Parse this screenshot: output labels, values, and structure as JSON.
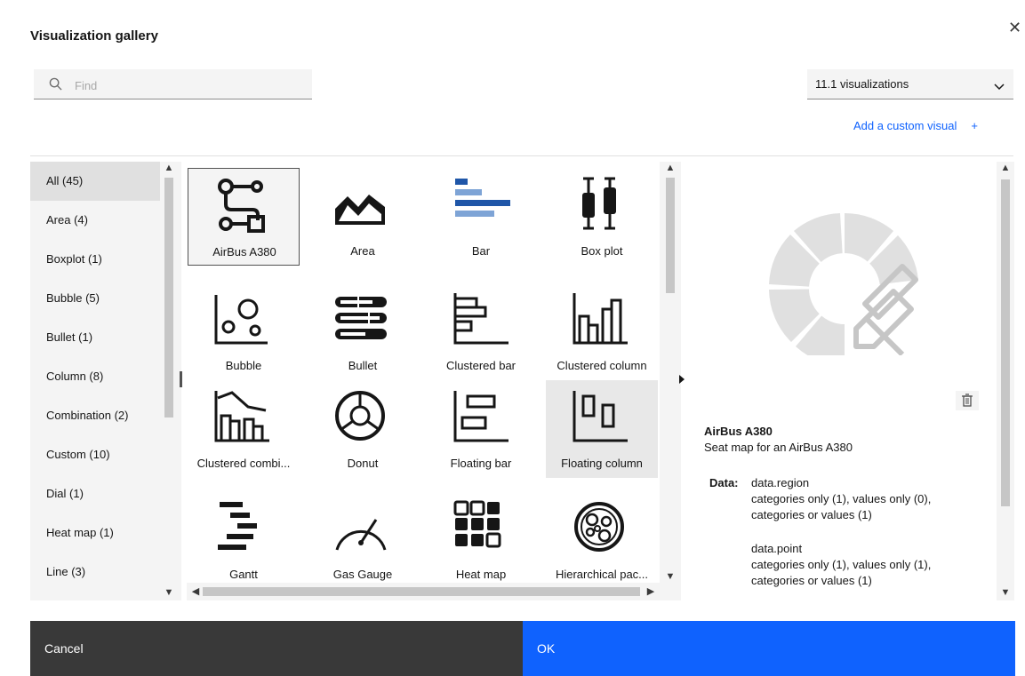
{
  "dialog": {
    "title": "Visualization gallery",
    "close_icon": "close-icon"
  },
  "search": {
    "placeholder": "Find",
    "value": "",
    "icon": "search-icon"
  },
  "version_select": {
    "value": "11.1 visualizations",
    "icon": "chevron-down-icon"
  },
  "add_custom": {
    "label": "Add a custom visual",
    "plus": "+"
  },
  "categories": [
    "All (45)",
    "Area (4)",
    "Boxplot (1)",
    "Bubble (5)",
    "Bullet (1)",
    "Column (8)",
    "Combination (2)",
    "Custom (10)",
    "Dial (1)",
    "Heat map (1)",
    "Line (3)"
  ],
  "selected_category": "All (45)",
  "tiles": [
    {
      "label": "AirBus A380",
      "icon": "route-icon",
      "state": "selected"
    },
    {
      "label": "Area",
      "icon": "area-chart-icon"
    },
    {
      "label": "Bar",
      "icon": "bar-chart-icon"
    },
    {
      "label": "Box plot",
      "icon": "box-plot-icon"
    },
    {
      "label": "Bubble",
      "icon": "bubble-chart-icon"
    },
    {
      "label": "Bullet",
      "icon": "bullet-chart-icon"
    },
    {
      "label": "Clustered bar",
      "icon": "clustered-bar-icon"
    },
    {
      "label": "Clustered column",
      "icon": "clustered-column-icon"
    },
    {
      "label": "Clustered combi...",
      "icon": "clustered-combination-icon"
    },
    {
      "label": "Donut",
      "icon": "donut-chart-icon"
    },
    {
      "label": "Floating bar",
      "icon": "floating-bar-icon"
    },
    {
      "label": "Floating column",
      "icon": "floating-column-icon",
      "state": "hover"
    },
    {
      "label": "Gantt",
      "icon": "gantt-chart-icon"
    },
    {
      "label": "Gas Gauge",
      "icon": "gauge-icon"
    },
    {
      "label": "Heat map",
      "icon": "heat-map-icon"
    },
    {
      "label": "Hierarchical pac...",
      "icon": "hierarchical-packing-icon"
    }
  ],
  "details": {
    "preview_icon": "custom-visual-preview-icon",
    "delete_icon": "trash-icon",
    "title": "AirBus A380",
    "description": "Seat map for an AirBus A380",
    "data_label": "Data:",
    "region": {
      "name": "data.region",
      "line1": "categories only (1),  values only (0),",
      "line2": "categories or values (1)"
    },
    "point": {
      "name": "data.point",
      "line1": "categories only (1),  values only (1),",
      "line2": "categories or values (1)"
    }
  },
  "footer": {
    "cancel_label": "Cancel",
    "ok_label": "OK"
  },
  "colors": {
    "primary": "#0f62fe",
    "secondary": "#393939",
    "bar_icon_dark": "#1f56a8",
    "bar_icon_light": "#7ea4d6"
  }
}
